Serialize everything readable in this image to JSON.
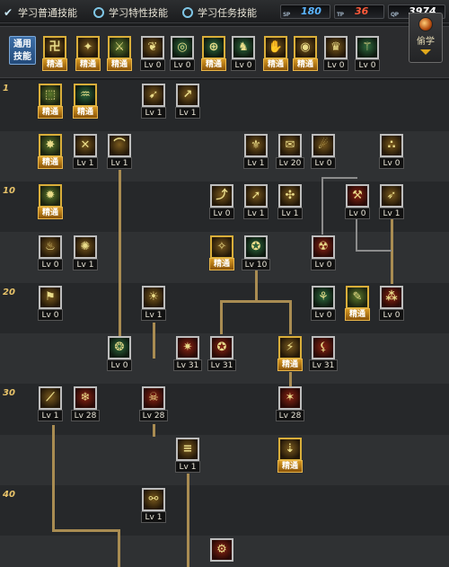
{
  "tabs": {
    "normal": "学习普通技能",
    "special": "学习特性技能",
    "quest": "学习任务技能"
  },
  "points": [
    {
      "label": "SP",
      "value": "180",
      "color": "#5ab4ff"
    },
    {
      "label": "TP",
      "value": "36",
      "color": "#ff5a3a"
    },
    {
      "label": "QP",
      "value": "3974",
      "color": "#ffffff"
    }
  ],
  "common": {
    "label": "通用技能",
    "skills": [
      {
        "glyph": "卍",
        "tag": "精通",
        "elite": true,
        "color": "brown"
      },
      {
        "glyph": "✦",
        "tag": "精通",
        "elite": true,
        "color": "brown"
      },
      {
        "glyph": "⚔",
        "tag": "精通",
        "elite": true,
        "color": "green"
      },
      {
        "glyph": "❦",
        "tag": "Lv 0",
        "elite": false,
        "color": "brown"
      },
      {
        "glyph": "◎",
        "tag": "Lv 0",
        "elite": false,
        "color": "teal"
      },
      {
        "glyph": "⊕",
        "tag": "精通",
        "elite": true,
        "color": "teal"
      },
      {
        "glyph": "♞",
        "tag": "Lv 0",
        "elite": false,
        "color": "teal"
      },
      {
        "glyph": "✋",
        "tag": "精通",
        "elite": true,
        "color": "brown"
      },
      {
        "glyph": "◉",
        "tag": "精通",
        "elite": true,
        "color": "brown"
      },
      {
        "glyph": "♛",
        "tag": "Lv 0",
        "elite": false,
        "color": "brown"
      },
      {
        "glyph": "⚚",
        "tag": "Lv 0",
        "elite": false,
        "color": "teal"
      }
    ]
  },
  "steal": {
    "label": "偷学"
  },
  "level_markers": [
    "1",
    "10",
    "20",
    "30",
    "40"
  ],
  "tree": [
    {
      "glyph": "⬚",
      "tag": "精通",
      "elite": true,
      "color": "green"
    },
    {
      "glyph": "♒",
      "tag": "精通",
      "elite": true,
      "color": "teal"
    },
    {
      "glyph": "➹",
      "tag": "Lv 1",
      "elite": false,
      "color": "brown"
    },
    {
      "glyph": "↗",
      "tag": "Lv 1",
      "elite": false,
      "color": "brown"
    },
    {
      "glyph": "✸",
      "tag": "精通",
      "elite": true,
      "color": "green"
    },
    {
      "glyph": "✕",
      "tag": "Lv 1",
      "elite": false,
      "color": "brown"
    },
    {
      "glyph": "⌒",
      "tag": "Lv 1",
      "elite": false,
      "color": "brown"
    },
    {
      "glyph": "⚜",
      "tag": "Lv 1",
      "elite": false,
      "color": "brown"
    },
    {
      "glyph": "✉",
      "tag": "Lv 20",
      "elite": false,
      "color": "brown"
    },
    {
      "glyph": "☄",
      "tag": "Lv 0",
      "elite": false,
      "color": "brown"
    },
    {
      "glyph": "∴",
      "tag": "Lv 0",
      "elite": false,
      "color": "brown"
    },
    {
      "glyph": "✹",
      "tag": "精通",
      "elite": true,
      "color": "green"
    },
    {
      "glyph": "⤴",
      "tag": "Lv 0",
      "elite": false,
      "color": "brown"
    },
    {
      "glyph": "➚",
      "tag": "Lv 1",
      "elite": false,
      "color": "brown"
    },
    {
      "glyph": "✣",
      "tag": "Lv 1",
      "elite": false,
      "color": "brown"
    },
    {
      "glyph": "⚒",
      "tag": "Lv 0",
      "elite": false,
      "color": "red"
    },
    {
      "glyph": "➶",
      "tag": "Lv 1",
      "elite": false,
      "color": "brown"
    },
    {
      "glyph": "♨",
      "tag": "Lv 0",
      "elite": false,
      "color": "brown"
    },
    {
      "glyph": "✺",
      "tag": "Lv 1",
      "elite": false,
      "color": "brown"
    },
    {
      "glyph": "✧",
      "tag": "精通",
      "elite": true,
      "color": "brown"
    },
    {
      "glyph": "✪",
      "tag": "Lv 10",
      "elite": false,
      "color": "teal"
    },
    {
      "glyph": "☢",
      "tag": "Lv 0",
      "elite": false,
      "color": "red"
    },
    {
      "glyph": "⚑",
      "tag": "Lv 0",
      "elite": false,
      "color": "brown"
    },
    {
      "glyph": "☀",
      "tag": "Lv 1",
      "elite": false,
      "color": "brown"
    },
    {
      "glyph": "⚘",
      "tag": "Lv 0",
      "elite": false,
      "color": "teal"
    },
    {
      "glyph": "✎",
      "tag": "精通",
      "elite": true,
      "color": "green"
    },
    {
      "glyph": "⁂",
      "tag": "Lv 0",
      "elite": false,
      "color": "red"
    },
    {
      "glyph": "❂",
      "tag": "Lv 0",
      "elite": false,
      "color": "teal"
    },
    {
      "glyph": "✷",
      "tag": "Lv 31",
      "elite": false,
      "color": "red"
    },
    {
      "glyph": "✪",
      "tag": "Lv 31",
      "elite": false,
      "color": "red"
    },
    {
      "glyph": "⚡",
      "tag": "精通",
      "elite": true,
      "color": "brown"
    },
    {
      "glyph": "⚸",
      "tag": "Lv 31",
      "elite": false,
      "color": "red"
    },
    {
      "glyph": "⟋",
      "tag": "Lv 1",
      "elite": false,
      "color": "brown"
    },
    {
      "glyph": "❄",
      "tag": "Lv 28",
      "elite": false,
      "color": "red"
    },
    {
      "glyph": "☠",
      "tag": "Lv 28",
      "elite": false,
      "color": "red"
    },
    {
      "glyph": "✶",
      "tag": "Lv 28",
      "elite": false,
      "color": "red"
    },
    {
      "glyph": "≡",
      "tag": "Lv 1",
      "elite": false,
      "color": "brown"
    },
    {
      "glyph": "⇣",
      "tag": "精通",
      "elite": true,
      "color": "brown"
    },
    {
      "glyph": "⚯",
      "tag": "Lv 1",
      "elite": false,
      "color": "brown"
    },
    {
      "glyph": "⚙",
      "tag": "",
      "elite": false,
      "color": "red"
    }
  ]
}
